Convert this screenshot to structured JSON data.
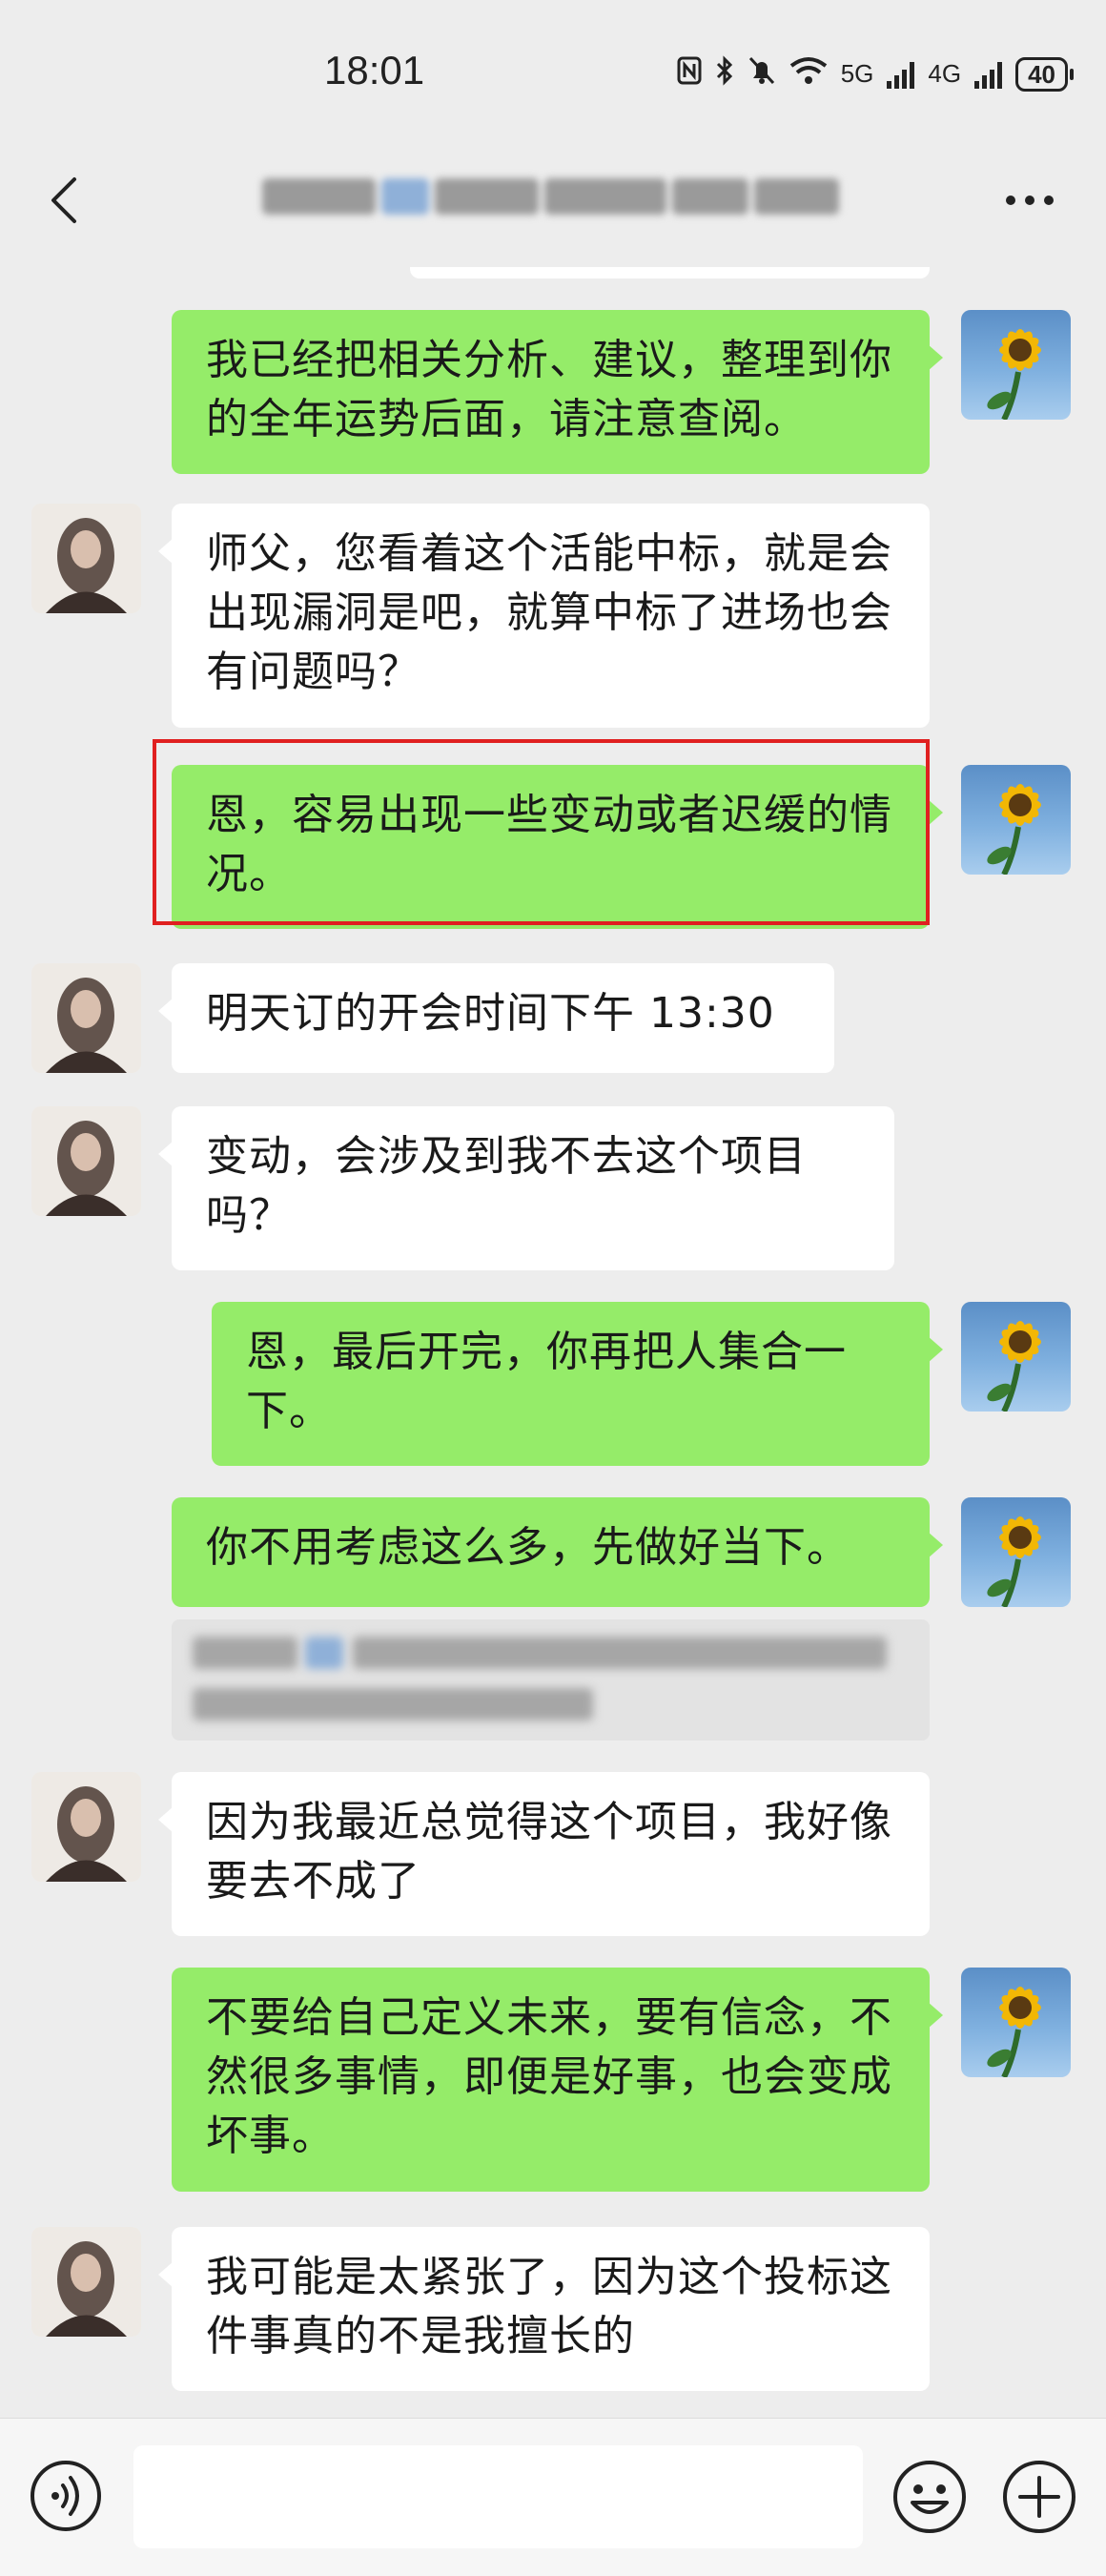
{
  "status": {
    "time": "18:01",
    "network_5g": "5G",
    "network_4g": "4G",
    "battery": "40"
  },
  "header": {
    "back_icon": "chevron-left-icon",
    "more_icon": "more-horizontal-icon"
  },
  "messages": [
    {
      "side": "out",
      "text": "我已经把相关分析、建议，整理到你的全年运势后面，请注意查阅。"
    },
    {
      "side": "in",
      "text": "师父，您看着这个活能中标，就是会出现漏洞是吧，就算中标了进场也会有问题吗？"
    },
    {
      "side": "out",
      "text": "恩，容易出现一些变动或者迟缓的情况。",
      "highlighted": true
    },
    {
      "side": "in",
      "text": "明天订的开会时间下午 13:30"
    },
    {
      "side": "in",
      "text": "变动，会涉及到我不去这个项目吗？"
    },
    {
      "side": "out",
      "text": "恩，最后开完，你再把人集合一下。"
    },
    {
      "side": "out",
      "text": "你不用考虑这么多，先做好当下。"
    },
    {
      "side": "in",
      "text": "因为我最近总觉得这个项目，我好像要去不成了"
    },
    {
      "side": "out",
      "text": "不要给自己定义未来，要有信念，不然很多事情，即便是好事，也会变成坏事。"
    },
    {
      "side": "in",
      "text": "我可能是太紧张了，因为这个投标这件事真的不是我擅长的"
    }
  ],
  "input_bar": {
    "voice_icon": "voice-icon",
    "emoji_icon": "emoji-icon",
    "plus_icon": "plus-icon",
    "input_value": ""
  },
  "colors": {
    "background": "#ededed",
    "outgoing_bubble": "#95ec69",
    "incoming_bubble": "#ffffff",
    "highlight_border": "#e02020"
  }
}
